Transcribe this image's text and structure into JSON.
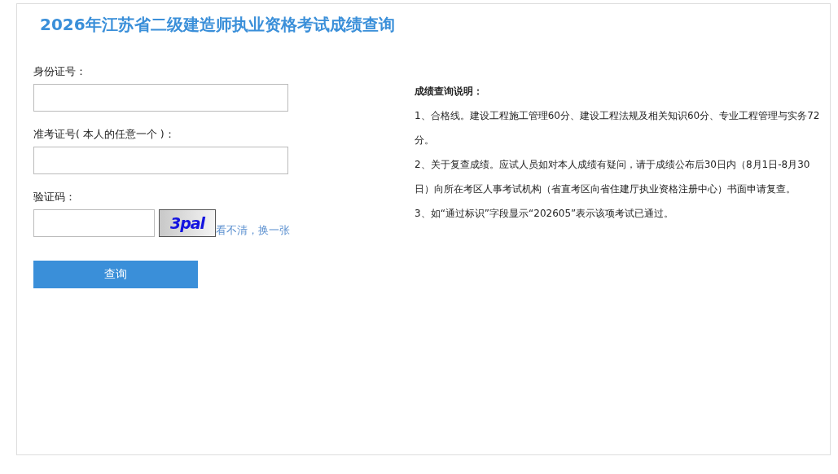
{
  "title": "2026年江苏省二级建造师执业资格考试成绩查询",
  "form": {
    "fields": [
      {
        "label": "身份证号：",
        "kind": "text"
      },
      {
        "label": "准考证号( 本人的任意一个 )：",
        "kind": "text"
      },
      {
        "label": "验证码：",
        "kind": "captcha",
        "captcha": "3pal",
        "refresh_link": "看不清，换一张"
      }
    ],
    "submit": "查询"
  },
  "notes": {
    "heading": "成绩查询说明：",
    "items": [
      "1、合格线。建设工程施工管理60分、建设工程法规及相关知识60分、专业工程管理与实务72分。",
      "2、关于复查成绩。应试人员如对本人成绩有疑问，请于成绩公布后30日内（8月1日-8月30日）向所在考区人事考试机构（省直考区向省住建厅执业资格注册中心）书面申请复查。",
      "3、如“通过标识”字段显示“202605”表示该项考试已通过。"
    ]
  }
}
